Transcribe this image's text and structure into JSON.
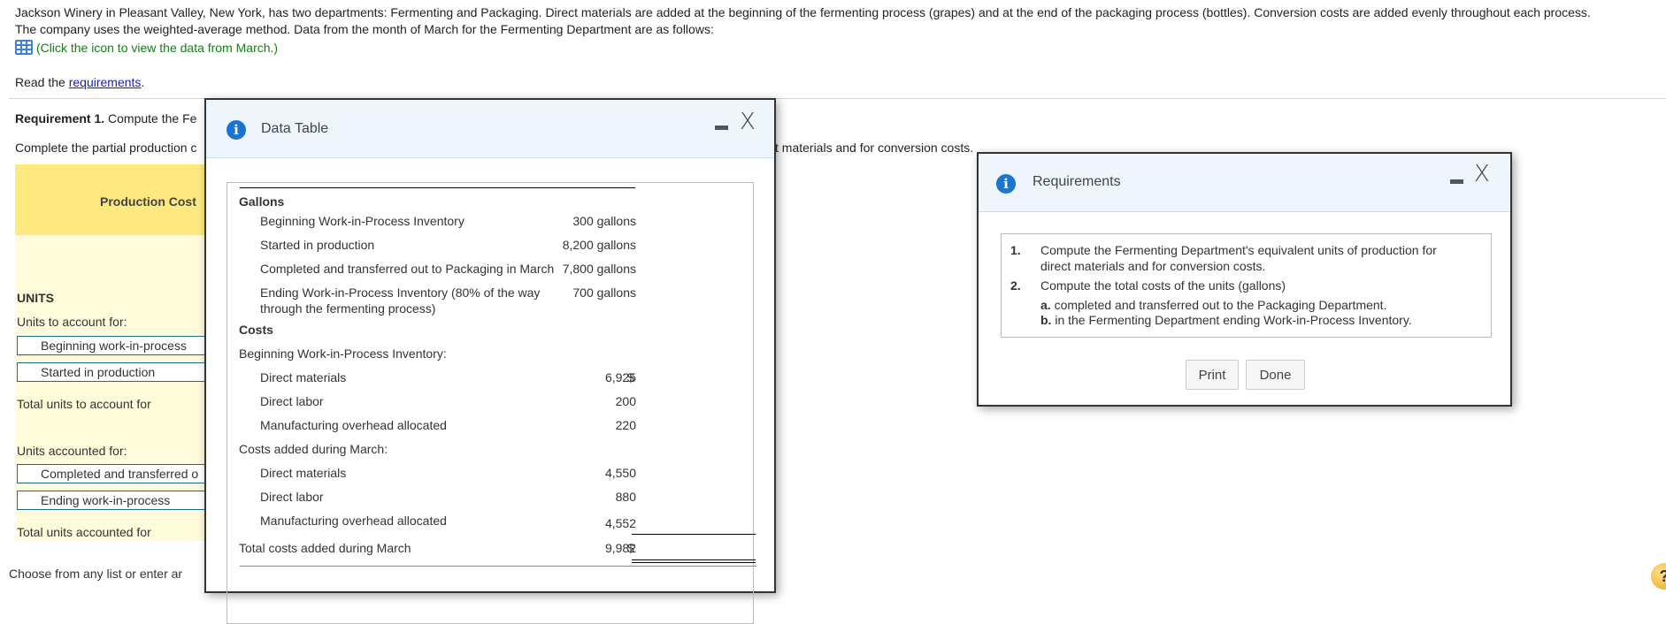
{
  "intro": {
    "line1": "Jackson Winery in Pleasant Valley, New York, has two departments: Fermenting and Packaging. Direct materials are added at the beginning of the fermenting process (grapes) and at the end of the packaging process (bottles). Conversion costs are added evenly throughout each process.",
    "line2": "The company uses the weighted-average method. Data from the month of March for the Fermenting Department are as follows:",
    "data_link": "(Click the icon to view the data from March.)",
    "read_prefix": "Read the ",
    "read_link": "requirements",
    "read_suffix": "."
  },
  "requirement1": {
    "label": "Requirement 1.",
    "text": " Compute the Fe",
    "partial_left": "Complete the partial production c",
    "partial_right": "t materials and for conversion costs."
  },
  "production_table": {
    "header": "Production Cost",
    "units_heading": "UNITS",
    "units_to_account": "Units to account for:",
    "beginning_wip": "Beginning work-in-process",
    "started": "Started in production",
    "total_to_account": "Total units to account for",
    "units_accounted": "Units accounted for:",
    "completed": "Completed and transferred o",
    "ending_wip": "Ending work-in-process",
    "total_accounted": "Total units accounted for"
  },
  "choose_text": "Choose from any list or enter ar",
  "data_dialog": {
    "title": "Data Table",
    "gallons_heading": "Gallons",
    "gallons": [
      {
        "label": "Beginning Work-in-Process Inventory",
        "value": "300 gallons"
      },
      {
        "label": "Started in production",
        "value": "8,200 gallons"
      },
      {
        "label": "Completed and transferred out to Packaging in March",
        "value": "7,800 gallons"
      },
      {
        "label": "Ending Work-in-Process Inventory (80% of the way",
        "label2": "through the fermenting process)",
        "value": "700 gallons"
      }
    ],
    "costs_heading": "Costs",
    "beginning_heading": "Beginning Work-in-Process Inventory:",
    "beginning": [
      {
        "label": "Direct materials",
        "dollar": "$",
        "value": "6,925"
      },
      {
        "label": "Direct labor",
        "value": "200"
      },
      {
        "label": "Manufacturing overhead allocated",
        "value": "220"
      }
    ],
    "added_heading": "Costs added during March:",
    "added": [
      {
        "label": "Direct materials",
        "value": "4,550"
      },
      {
        "label": "Direct labor",
        "value": "880"
      },
      {
        "label": "Manufacturing overhead allocated",
        "value": "4,552"
      }
    ],
    "total": {
      "label": "Total costs added during March",
      "dollar": "$",
      "value": "9,982"
    }
  },
  "req_dialog": {
    "title": "Requirements",
    "items": [
      {
        "num": "1.",
        "line1": "Compute the Fermenting Department's equivalent units of production for",
        "line2": "direct materials and for conversion costs."
      },
      {
        "num": "2.",
        "line1": "Compute the total costs of the units (gallons)"
      }
    ],
    "subs": [
      {
        "letter": "a.",
        "text": " completed and transferred out to the Packaging Department."
      },
      {
        "letter": "b.",
        "text": " in the Fermenting Department ending Work-in-Process Inventory."
      }
    ],
    "print_label": "Print",
    "done_label": "Done"
  },
  "icons": {
    "info": "i",
    "close": "X",
    "help": "?"
  }
}
